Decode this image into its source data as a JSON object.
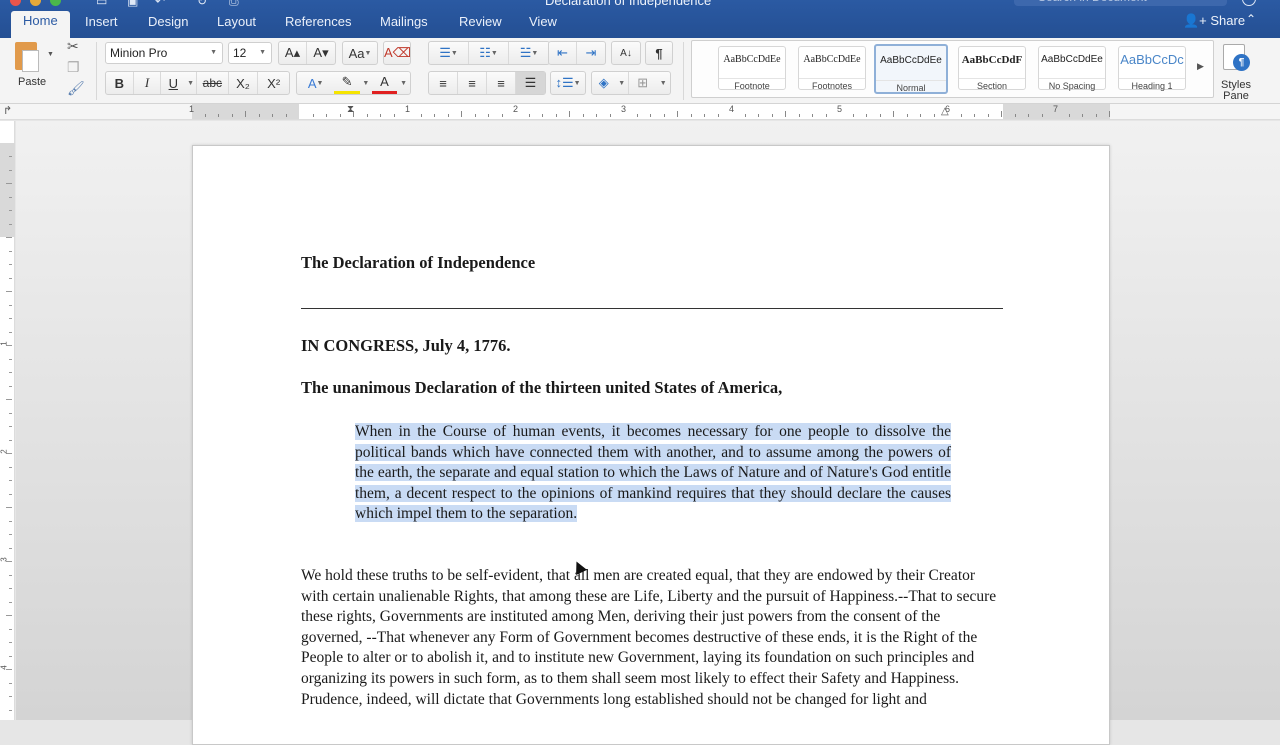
{
  "window": {
    "title": "Declaration of Independence",
    "search_placeholder": "Search in Document",
    "share_label": "Share",
    "quick_access_icons": [
      "sidebar-icon",
      "save-icon",
      "undo-icon",
      "redo-icon",
      "print-icon"
    ]
  },
  "tabs": [
    {
      "label": "Home",
      "active": true
    },
    {
      "label": "Insert"
    },
    {
      "label": "Design"
    },
    {
      "label": "Layout"
    },
    {
      "label": "References"
    },
    {
      "label": "Mailings"
    },
    {
      "label": "Review"
    },
    {
      "label": "View"
    }
  ],
  "ribbon": {
    "paste_label": "Paste",
    "font_name": "Minion Pro",
    "font_size": "12",
    "bold": "B",
    "italic": "I",
    "underline": "U",
    "strikethrough": "abc",
    "subscript": "X₂",
    "superscript": "X²",
    "grow_font": "A▴",
    "shrink_font": "A▾",
    "change_case": "Aa",
    "pilcrow": "¶",
    "colors": {
      "highlight": "#f5e400",
      "font_color": "#e02020",
      "accent": "#2b5aa3"
    },
    "styles": [
      {
        "preview": "AaBbCcDdEe",
        "name": "Footnote"
      },
      {
        "preview": "AaBbCcDdEe",
        "name": "Footnotes"
      },
      {
        "preview": "AaBbCcDdEe",
        "name": "Normal",
        "selected": true
      },
      {
        "preview": "AaBbCcDdF",
        "name": "Section"
      },
      {
        "preview": "AaBbCcDdEe",
        "name": "No Spacing"
      },
      {
        "preview": "AaBbCcDc",
        "name": "Heading 1"
      }
    ],
    "styles_pane_label": "Styles Pane"
  },
  "ruler": {
    "h_numbers": [
      "1",
      "1",
      "2",
      "3",
      "4",
      "5",
      "6",
      "7"
    ],
    "v_numbers": [
      "1",
      "2",
      "3",
      "4"
    ]
  },
  "document": {
    "title": "The Declaration of Independence",
    "congress": "IN CONGRESS, July 4, 1776.",
    "subtitle": "The unanimous Declaration of the thirteen united States of America,",
    "quote": "When in the Course of human events, it becomes necessary for one people to dissolve the political bands which have connected them with another, and to assume among the powers of the earth, the separate and equal station to which the Laws of Nature and of Nature's God entitle them, a decent respect to the opinions of mankind requires that they should declare the causes which impel them to the separation.",
    "paragraph": "We hold these truths to be self-evident, that all men are created equal, that they are endowed by their Creator with certain unalienable Rights, that among these are Life, Liberty and the pursuit of Happiness.--That to secure these rights, Governments are instituted among Men, deriving their just powers from the consent of the governed, --That whenever any Form of Government becomes destructive of these ends, it is the Right of the People to alter or to abolish it, and to institute new Government, laying its foundation on such principles and organizing its powers in such form, as to them shall seem most likely to effect their Safety and Happiness. Prudence, indeed, will dictate that Governments long established should not be changed for light and"
  }
}
